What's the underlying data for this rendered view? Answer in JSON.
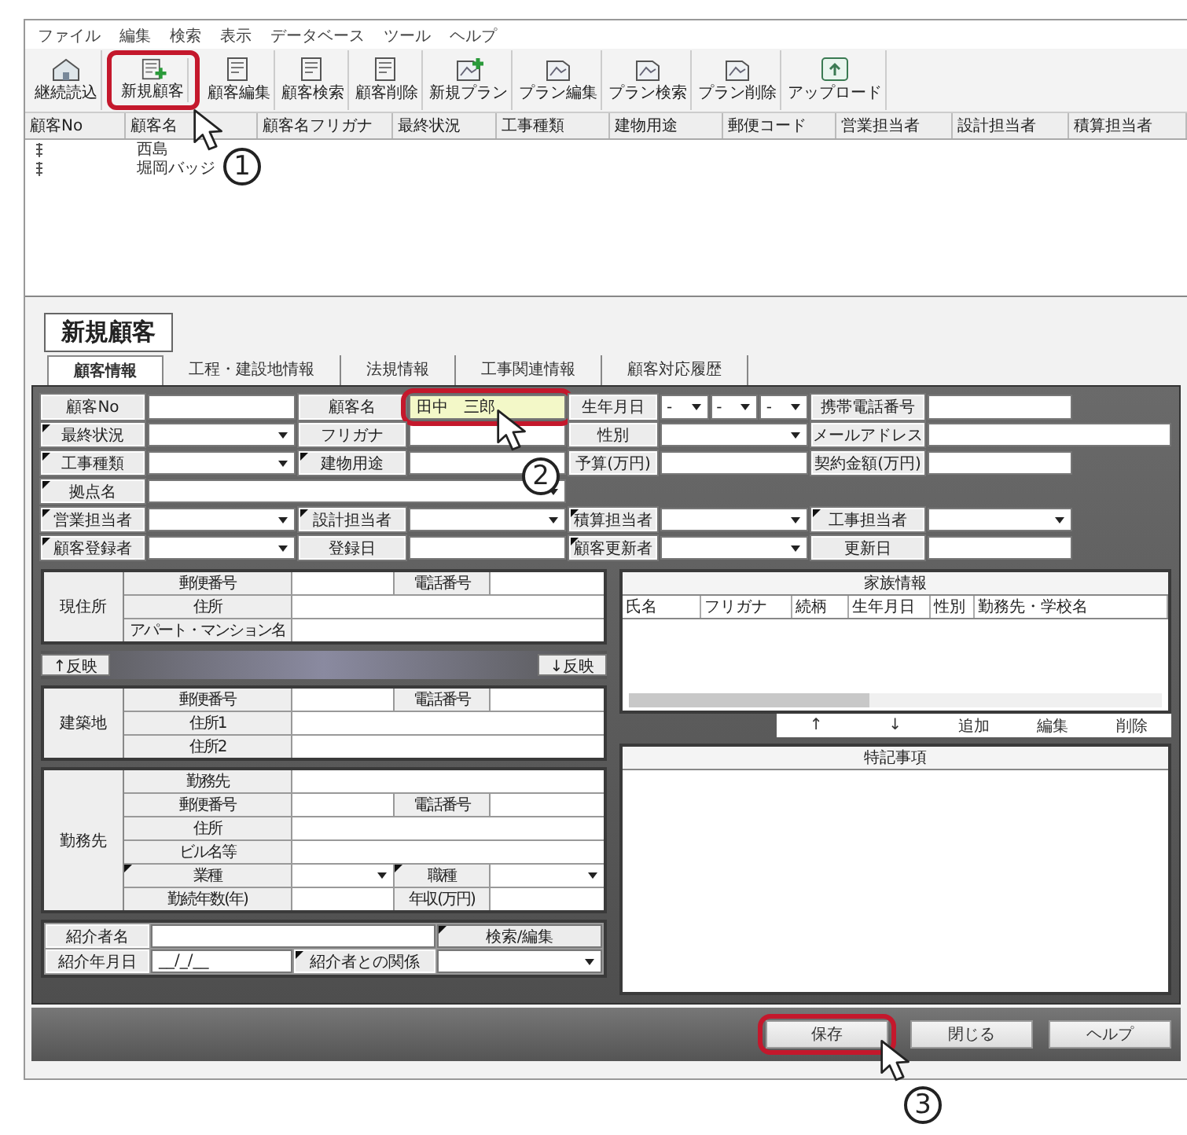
{
  "menu": [
    "ファイル",
    "編集",
    "検索",
    "表示",
    "データベース",
    "ツール",
    "ヘルプ"
  ],
  "toolbar": [
    {
      "label": "継続読込",
      "kind": "house"
    },
    {
      "label": "新規顧客",
      "kind": "doc-add",
      "callout": "1"
    },
    {
      "label": "顧客編集",
      "kind": "doc"
    },
    {
      "label": "顧客検索",
      "kind": "doc"
    },
    {
      "label": "顧客削除",
      "kind": "doc"
    },
    {
      "label": "新規プラン",
      "kind": "plan-add"
    },
    {
      "label": "プラン編集",
      "kind": "plan"
    },
    {
      "label": "プラン検索",
      "kind": "plan"
    },
    {
      "label": "プラン削除",
      "kind": "plan"
    },
    {
      "label": "アップロード",
      "kind": "upload"
    }
  ],
  "list": {
    "columns": [
      "顧客No",
      "顧客名",
      "顧客名フリガナ",
      "最終状況",
      "工事種類",
      "建物用途",
      "郵便コード",
      "営業担当者",
      "設計担当者",
      "積算担当者"
    ],
    "rows": [
      {
        "name": "西島"
      },
      {
        "name": "堀岡バッジ"
      }
    ]
  },
  "form": {
    "title": "新規顧客",
    "tabs": [
      {
        "label": "顧客情報",
        "selected": true
      },
      {
        "label": "工程・建設地情報",
        "selected": false
      },
      {
        "label": "法規情報",
        "selected": false
      },
      {
        "label": "工事関連情報",
        "selected": false
      },
      {
        "label": "顧客対応履歴",
        "selected": false
      }
    ],
    "rows": [
      [
        {
          "kind": "label",
          "text": "顧客No",
          "marked": false
        },
        {
          "kind": "input"
        },
        {
          "kind": "label",
          "text": "顧客名",
          "marked": false
        },
        {
          "kind": "input",
          "value": "田中　三郎",
          "highlighted": true,
          "callout": "2"
        },
        {
          "kind": "label",
          "text": "生年月日",
          "marked": false
        },
        {
          "kind": "date3",
          "values": [
            "-",
            "-",
            "-"
          ]
        },
        {
          "kind": "label",
          "text": "携帯電話番号",
          "marked": false
        },
        {
          "kind": "input"
        }
      ],
      [
        {
          "kind": "label",
          "text": "最終状況",
          "marked": true
        },
        {
          "kind": "select"
        },
        {
          "kind": "label",
          "text": "フリガナ",
          "marked": false
        },
        {
          "kind": "input"
        },
        {
          "kind": "label",
          "text": "性別",
          "marked": false
        },
        {
          "kind": "select"
        },
        {
          "kind": "label",
          "text": "メールアドレス",
          "marked": false
        },
        {
          "kind": "input_wide"
        }
      ],
      [
        {
          "kind": "label",
          "text": "工事種類",
          "marked": true
        },
        {
          "kind": "select"
        },
        {
          "kind": "label",
          "text": "建物用途",
          "marked": true
        },
        {
          "kind": "input"
        },
        {
          "kind": "label",
          "text": "予算(万円)",
          "marked": false
        },
        {
          "kind": "input"
        },
        {
          "kind": "label",
          "text": "契約金額(万円)",
          "marked": false
        },
        {
          "kind": "input"
        }
      ],
      [
        {
          "kind": "label",
          "text": "拠点名",
          "marked": true
        },
        {
          "kind": "select_wide"
        }
      ],
      [
        {
          "kind": "label",
          "text": "営業担当者",
          "marked": true
        },
        {
          "kind": "select"
        },
        {
          "kind": "label",
          "text": "設計担当者",
          "marked": true
        },
        {
          "kind": "select"
        },
        {
          "kind": "label",
          "text": "積算担当者",
          "marked": true
        },
        {
          "kind": "select"
        },
        {
          "kind": "label",
          "text": "工事担当者",
          "marked": true
        },
        {
          "kind": "select"
        }
      ],
      [
        {
          "kind": "label",
          "text": "顧客登録者",
          "marked": true
        },
        {
          "kind": "select"
        },
        {
          "kind": "label",
          "text": "登録日",
          "marked": false
        },
        {
          "kind": "input"
        },
        {
          "kind": "label",
          "text": "顧客更新者",
          "marked": true
        },
        {
          "kind": "select"
        },
        {
          "kind": "label",
          "text": "更新日",
          "marked": false
        },
        {
          "kind": "input"
        }
      ]
    ],
    "blocks": [
      {
        "title": "現住所",
        "rows": [
          [
            {
              "kind": "label",
              "text": "郵便番号",
              "marked": false
            },
            {
              "kind": "input"
            },
            {
              "kind": "label",
              "text": "電話番号",
              "marked": false
            },
            {
              "kind": "input"
            }
          ],
          [
            {
              "kind": "label",
              "text": "住所",
              "marked": false
            },
            {
              "kind": "input_wide"
            }
          ],
          [
            {
              "kind": "label",
              "text": "アパート・マンション名",
              "marked": false
            },
            {
              "kind": "input_wide"
            }
          ]
        ]
      },
      {
        "title": "建築地",
        "rows": [
          [
            {
              "kind": "label",
              "text": "郵便番号",
              "marked": false
            },
            {
              "kind": "input"
            },
            {
              "kind": "label",
              "text": "電話番号",
              "marked": false
            },
            {
              "kind": "input"
            }
          ],
          [
            {
              "kind": "label",
              "text": "住所1",
              "marked": false
            },
            {
              "kind": "input_wide"
            }
          ],
          [
            {
              "kind": "label",
              "text": "住所2",
              "marked": false
            },
            {
              "kind": "input_wide"
            }
          ]
        ]
      },
      {
        "title": "勤務先",
        "rows": [
          [
            {
              "kind": "label",
              "text": "勤務先",
              "marked": false
            },
            {
              "kind": "input_wide"
            }
          ],
          [
            {
              "kind": "label",
              "text": "郵便番号",
              "marked": false
            },
            {
              "kind": "input"
            },
            {
              "kind": "label",
              "text": "電話番号",
              "marked": false
            },
            {
              "kind": "input"
            }
          ],
          [
            {
              "kind": "label",
              "text": "住所",
              "marked": false
            },
            {
              "kind": "input_wide"
            }
          ],
          [
            {
              "kind": "label",
              "text": "ビル名等",
              "marked": false
            },
            {
              "kind": "input_wide"
            }
          ],
          [
            {
              "kind": "label",
              "text": "業種",
              "marked": true
            },
            {
              "kind": "select"
            },
            {
              "kind": "label",
              "text": "職種",
              "marked": true
            },
            {
              "kind": "select"
            }
          ],
          [
            {
              "kind": "label",
              "text": "勤続年数(年)",
              "marked": false
            },
            {
              "kind": "input"
            },
            {
              "kind": "label",
              "text": "年収(万円)",
              "marked": false
            },
            {
              "kind": "input"
            }
          ]
        ]
      }
    ],
    "reflect_buttons": [
      "↑反映",
      "↓反映"
    ],
    "introducer": [
      [
        {
          "kind": "label",
          "text": "紹介者名",
          "marked": false
        },
        {
          "kind": "input_wide"
        },
        {
          "kind": "button",
          "text": "検索/編集",
          "marked": true
        }
      ],
      [
        {
          "kind": "label",
          "text": "紹介年月日",
          "marked": false
        },
        {
          "kind": "input",
          "value": "__/_/__"
        },
        {
          "kind": "label",
          "text": "紹介者との関係",
          "marked": true
        },
        {
          "kind": "select"
        }
      ]
    ],
    "family": {
      "title": "家族情報",
      "columns": [
        "氏名",
        "フリガナ",
        "続柄",
        "生年月日",
        "性別",
        "勤務先・学校名"
      ],
      "buttons": [
        "↑",
        "↓",
        "追加",
        "編集",
        "削除"
      ]
    },
    "notes": {
      "title": "特記事項"
    },
    "footer_buttons": [
      {
        "label": "保存",
        "callout": "3"
      },
      {
        "label": "閉じる"
      },
      {
        "label": "ヘルプ"
      }
    ]
  }
}
